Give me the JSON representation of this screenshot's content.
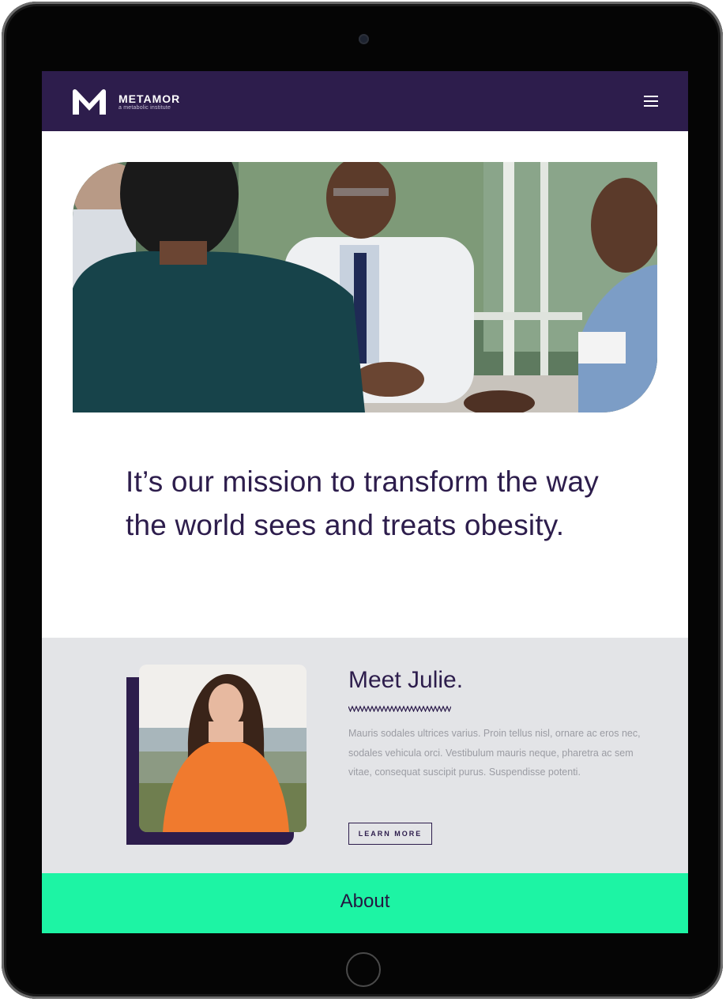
{
  "header": {
    "brand_name": "METAMOR",
    "brand_tagline": "a metabolic institute",
    "menu_icon": "hamburger-menu-icon",
    "background_color": "#2d1d4c"
  },
  "hero": {
    "image_description_icon": "doctor-consultation-photo"
  },
  "mission": {
    "text": "It’s our mission to transform the way the world sees and treats obesity."
  },
  "story": {
    "title": "Meet Julie.",
    "body": "Mauris sodales ultrices varius. Proin tellus nisl, ornare ac eros nec, sodales vehicula orci. Vestibulum mauris neque, pharetra ac sem vitae, consequat suscipit purus. Suspendisse potenti.",
    "button_label": "LEARN MORE"
  },
  "footer_nav": {
    "label": "About",
    "color": "#1df4a4"
  },
  "colors": {
    "brand_purple": "#2d1d4c",
    "band_gray": "#e3e4e7",
    "accent_green": "#1df4a4"
  }
}
